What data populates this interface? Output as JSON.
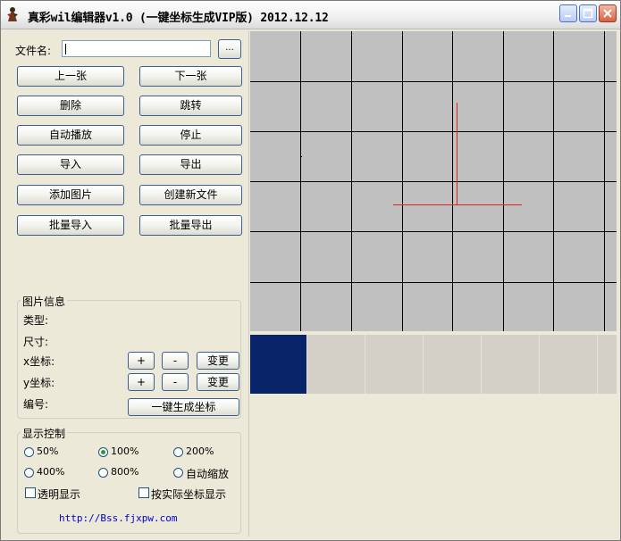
{
  "window": {
    "title": "真彩wil编辑器v1.0 (一键坐标生成VIP版) 2012.12.12"
  },
  "file": {
    "label": "文件名:",
    "value": "",
    "browse_label": "..."
  },
  "buttons": {
    "prev": "上一张",
    "next": "下一张",
    "delete": "删除",
    "jump": "跳转",
    "autoplay": "自动播放",
    "stop": "停止",
    "import": "导入",
    "export": "导出",
    "add_image": "添加图片",
    "create_file": "创建新文件",
    "batch_import": "批量导入",
    "batch_export": "批量导出"
  },
  "image_info": {
    "title": "图片信息",
    "type_label": "类型:",
    "size_label": "尺寸:",
    "x_label": "x坐标:",
    "y_label": "y坐标:",
    "id_label": "编号:",
    "plus": "+",
    "minus": "-",
    "change": "变更",
    "gen_coords": "一键生成坐标"
  },
  "display": {
    "title": "显示控制",
    "options": [
      "50%",
      "100%",
      "200%",
      "400%",
      "800%",
      "自动缩放"
    ],
    "selected": "100%",
    "transparent": "透明显示",
    "actual_coords": "按实际坐标显示",
    "link": "http://Bss.fjxpw.com"
  },
  "colors": {
    "selected_thumb": "#0a246a",
    "canvas_bg": "#c0c0c0",
    "crosshair": "#e02020"
  },
  "icons": {
    "app": "app-figure-icon",
    "minimize": "minimize-icon",
    "maximize": "maximize-icon",
    "close": "close-icon"
  }
}
